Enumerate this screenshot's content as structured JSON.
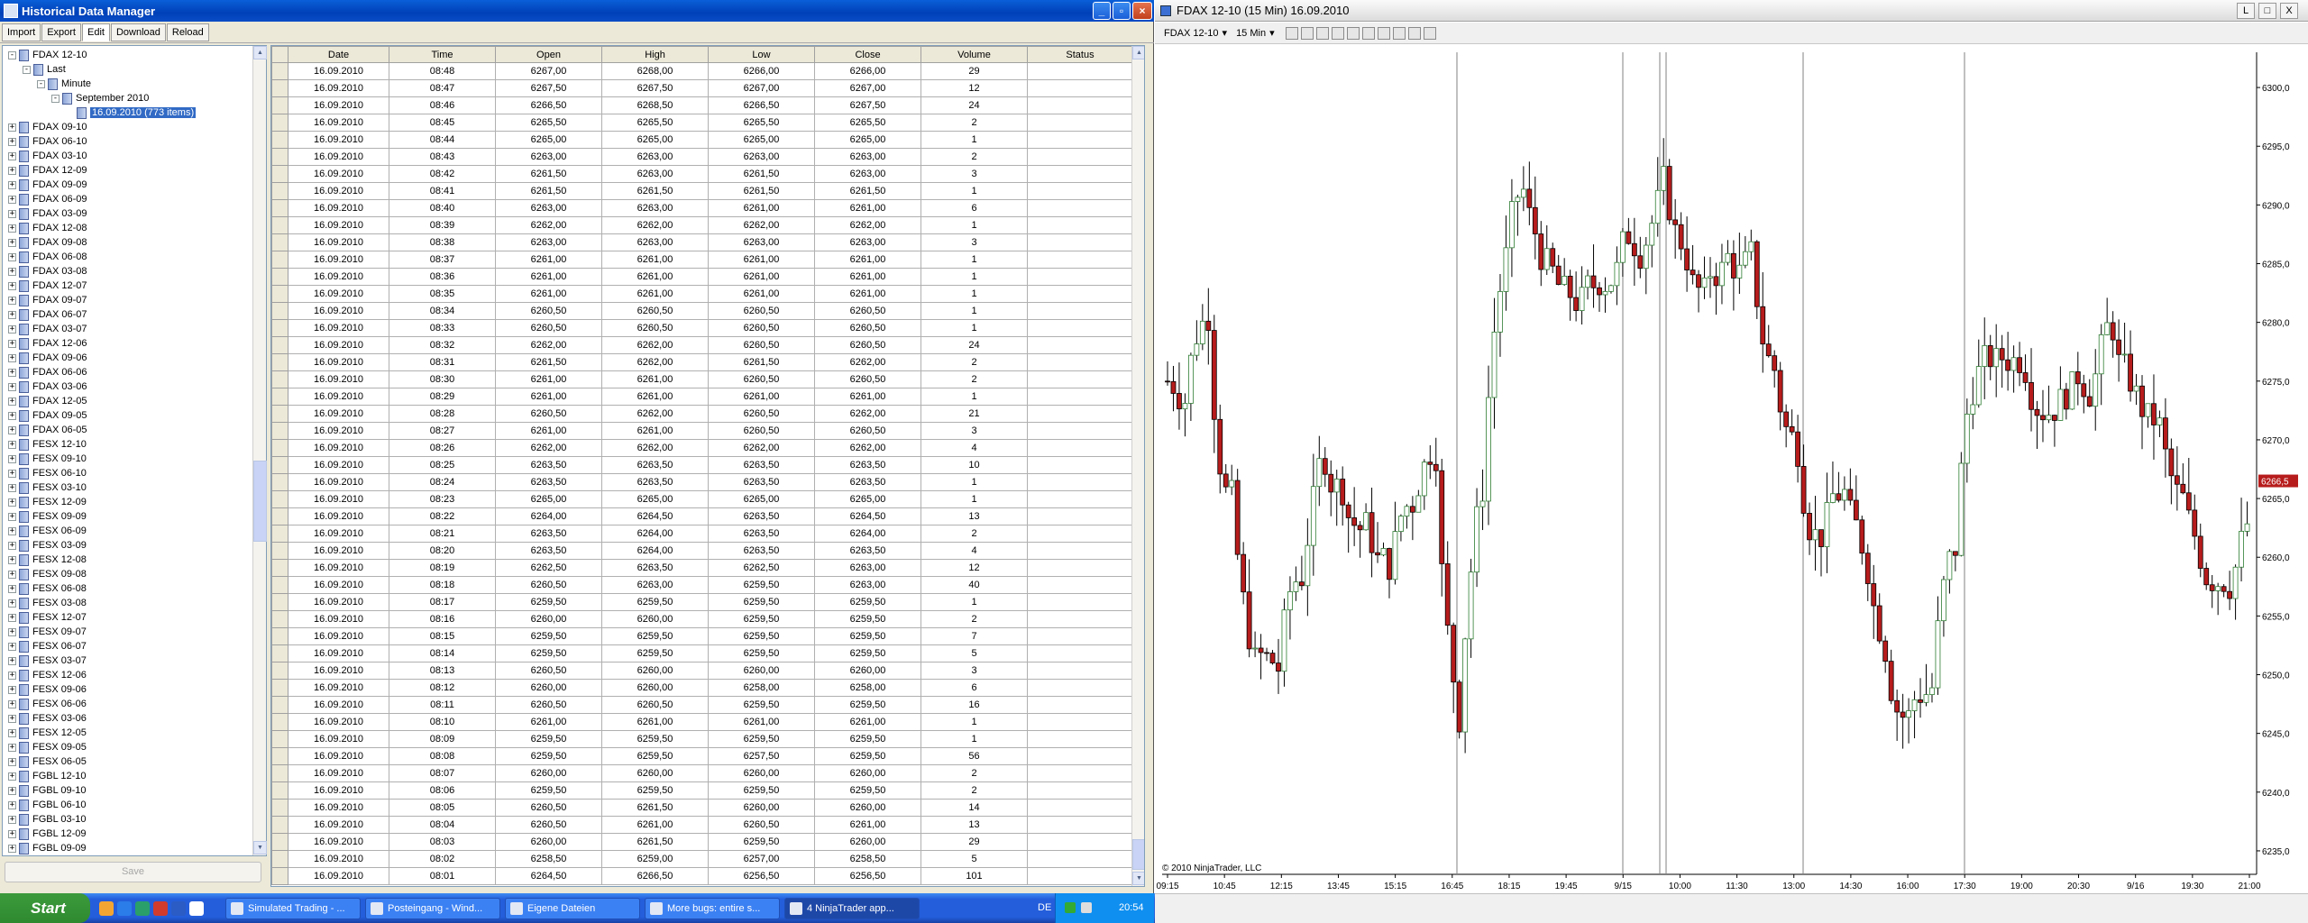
{
  "hdm": {
    "title": "Historical Data Manager",
    "menu": [
      "Import",
      "Export",
      "Edit",
      "Download",
      "Reload"
    ],
    "save": "Save"
  },
  "tree": {
    "top": [
      {
        "t": "FDAX 12-10",
        "lvl": 0,
        "pm": "-"
      },
      {
        "t": "Last",
        "lvl": 1,
        "pm": "-"
      },
      {
        "t": "Minute",
        "lvl": 2,
        "pm": "-"
      },
      {
        "t": "September 2010",
        "lvl": 3,
        "pm": "-"
      },
      {
        "t": "16.09.2010 (773 items)",
        "lvl": 4,
        "pm": "",
        "sel": true
      }
    ],
    "items": [
      "FDAX 09-10",
      "FDAX 06-10",
      "FDAX 03-10",
      "FDAX 12-09",
      "FDAX 09-09",
      "FDAX 06-09",
      "FDAX 03-09",
      "FDAX 12-08",
      "FDAX 09-08",
      "FDAX 06-08",
      "FDAX 03-08",
      "FDAX 12-07",
      "FDAX 09-07",
      "FDAX 06-07",
      "FDAX 03-07",
      "FDAX 12-06",
      "FDAX 09-06",
      "FDAX 06-06",
      "FDAX 03-06",
      "FDAX 12-05",
      "FDAX 09-05",
      "FDAX 06-05",
      "FESX 12-10",
      "FESX 09-10",
      "FESX 06-10",
      "FESX 03-10",
      "FESX 12-09",
      "FESX 09-09",
      "FESX 06-09",
      "FESX 03-09",
      "FESX 12-08",
      "FESX 09-08",
      "FESX 06-08",
      "FESX 03-08",
      "FESX 12-07",
      "FESX 09-07",
      "FESX 06-07",
      "FESX 03-07",
      "FESX 12-06",
      "FESX 09-06",
      "FESX 06-06",
      "FESX 03-06",
      "FESX 12-05",
      "FESX 09-05",
      "FESX 06-05",
      "FGBL 12-10",
      "FGBL 09-10",
      "FGBL 06-10",
      "FGBL 03-10",
      "FGBL 12-09",
      "FGBL 09-09"
    ]
  },
  "grid": {
    "columns": [
      "Date",
      "Time",
      "Open",
      "High",
      "Low",
      "Close",
      "Volume",
      "Status"
    ],
    "rows": [
      [
        "16.09.2010",
        "08:48",
        "6267,00",
        "6268,00",
        "6266,00",
        "6266,00",
        "29"
      ],
      [
        "16.09.2010",
        "08:47",
        "6267,50",
        "6267,50",
        "6267,00",
        "6267,00",
        "12"
      ],
      [
        "16.09.2010",
        "08:46",
        "6266,50",
        "6268,50",
        "6266,50",
        "6267,50",
        "24"
      ],
      [
        "16.09.2010",
        "08:45",
        "6265,50",
        "6265,50",
        "6265,50",
        "6265,50",
        "2"
      ],
      [
        "16.09.2010",
        "08:44",
        "6265,00",
        "6265,00",
        "6265,00",
        "6265,00",
        "1"
      ],
      [
        "16.09.2010",
        "08:43",
        "6263,00",
        "6263,00",
        "6263,00",
        "6263,00",
        "2"
      ],
      [
        "16.09.2010",
        "08:42",
        "6261,50",
        "6263,00",
        "6261,50",
        "6263,00",
        "3"
      ],
      [
        "16.09.2010",
        "08:41",
        "6261,50",
        "6261,50",
        "6261,50",
        "6261,50",
        "1"
      ],
      [
        "16.09.2010",
        "08:40",
        "6263,00",
        "6263,00",
        "6261,00",
        "6261,00",
        "6"
      ],
      [
        "16.09.2010",
        "08:39",
        "6262,00",
        "6262,00",
        "6262,00",
        "6262,00",
        "1"
      ],
      [
        "16.09.2010",
        "08:38",
        "6263,00",
        "6263,00",
        "6263,00",
        "6263,00",
        "3"
      ],
      [
        "16.09.2010",
        "08:37",
        "6261,00",
        "6261,00",
        "6261,00",
        "6261,00",
        "1"
      ],
      [
        "16.09.2010",
        "08:36",
        "6261,00",
        "6261,00",
        "6261,00",
        "6261,00",
        "1"
      ],
      [
        "16.09.2010",
        "08:35",
        "6261,00",
        "6261,00",
        "6261,00",
        "6261,00",
        "1"
      ],
      [
        "16.09.2010",
        "08:34",
        "6260,50",
        "6260,50",
        "6260,50",
        "6260,50",
        "1"
      ],
      [
        "16.09.2010",
        "08:33",
        "6260,50",
        "6260,50",
        "6260,50",
        "6260,50",
        "1"
      ],
      [
        "16.09.2010",
        "08:32",
        "6262,00",
        "6262,00",
        "6260,50",
        "6260,50",
        "24"
      ],
      [
        "16.09.2010",
        "08:31",
        "6261,50",
        "6262,00",
        "6261,50",
        "6262,00",
        "2"
      ],
      [
        "16.09.2010",
        "08:30",
        "6261,00",
        "6261,00",
        "6260,50",
        "6260,50",
        "2"
      ],
      [
        "16.09.2010",
        "08:29",
        "6261,00",
        "6261,00",
        "6261,00",
        "6261,00",
        "1"
      ],
      [
        "16.09.2010",
        "08:28",
        "6260,50",
        "6262,00",
        "6260,50",
        "6262,00",
        "21"
      ],
      [
        "16.09.2010",
        "08:27",
        "6261,00",
        "6261,00",
        "6260,50",
        "6260,50",
        "3"
      ],
      [
        "16.09.2010",
        "08:26",
        "6262,00",
        "6262,00",
        "6262,00",
        "6262,00",
        "4"
      ],
      [
        "16.09.2010",
        "08:25",
        "6263,50",
        "6263,50",
        "6263,50",
        "6263,50",
        "10"
      ],
      [
        "16.09.2010",
        "08:24",
        "6263,50",
        "6263,50",
        "6263,50",
        "6263,50",
        "1"
      ],
      [
        "16.09.2010",
        "08:23",
        "6265,00",
        "6265,00",
        "6265,00",
        "6265,00",
        "1"
      ],
      [
        "16.09.2010",
        "08:22",
        "6264,00",
        "6264,50",
        "6263,50",
        "6264,50",
        "13"
      ],
      [
        "16.09.2010",
        "08:21",
        "6263,50",
        "6264,00",
        "6263,50",
        "6264,00",
        "2"
      ],
      [
        "16.09.2010",
        "08:20",
        "6263,50",
        "6264,00",
        "6263,50",
        "6263,50",
        "4"
      ],
      [
        "16.09.2010",
        "08:19",
        "6262,50",
        "6263,50",
        "6262,50",
        "6263,00",
        "12"
      ],
      [
        "16.09.2010",
        "08:18",
        "6260,50",
        "6263,00",
        "6259,50",
        "6263,00",
        "40"
      ],
      [
        "16.09.2010",
        "08:17",
        "6259,50",
        "6259,50",
        "6259,50",
        "6259,50",
        "1"
      ],
      [
        "16.09.2010",
        "08:16",
        "6260,00",
        "6260,00",
        "6259,50",
        "6259,50",
        "2"
      ],
      [
        "16.09.2010",
        "08:15",
        "6259,50",
        "6259,50",
        "6259,50",
        "6259,50",
        "7"
      ],
      [
        "16.09.2010",
        "08:14",
        "6259,50",
        "6259,50",
        "6259,50",
        "6259,50",
        "5"
      ],
      [
        "16.09.2010",
        "08:13",
        "6260,50",
        "6260,00",
        "6260,00",
        "6260,00",
        "3"
      ],
      [
        "16.09.2010",
        "08:12",
        "6260,00",
        "6260,00",
        "6258,00",
        "6258,00",
        "6"
      ],
      [
        "16.09.2010",
        "08:11",
        "6260,50",
        "6260,50",
        "6259,50",
        "6259,50",
        "16"
      ],
      [
        "16.09.2010",
        "08:10",
        "6261,00",
        "6261,00",
        "6261,00",
        "6261,00",
        "1"
      ],
      [
        "16.09.2010",
        "08:09",
        "6259,50",
        "6259,50",
        "6259,50",
        "6259,50",
        "1"
      ],
      [
        "16.09.2010",
        "08:08",
        "6259,50",
        "6259,50",
        "6257,50",
        "6259,50",
        "56"
      ],
      [
        "16.09.2010",
        "08:07",
        "6260,00",
        "6260,00",
        "6260,00",
        "6260,00",
        "2"
      ],
      [
        "16.09.2010",
        "08:06",
        "6259,50",
        "6259,50",
        "6259,50",
        "6259,50",
        "2"
      ],
      [
        "16.09.2010",
        "08:05",
        "6260,50",
        "6261,50",
        "6260,00",
        "6260,00",
        "14"
      ],
      [
        "16.09.2010",
        "08:04",
        "6260,50",
        "6261,00",
        "6260,50",
        "6261,00",
        "13"
      ],
      [
        "16.09.2010",
        "08:03",
        "6260,00",
        "6261,50",
        "6259,50",
        "6260,00",
        "29"
      ],
      [
        "16.09.2010",
        "08:02",
        "6258,50",
        "6259,00",
        "6257,00",
        "6258,50",
        "5"
      ],
      [
        "16.09.2010",
        "08:01",
        "6264,50",
        "6266,50",
        "6256,50",
        "6256,50",
        "101"
      ]
    ]
  },
  "ninja": {
    "title": "FDAX 12-10 (15 Min)  16.09.2010",
    "instrument": "FDAX 12-10",
    "interval": "15 Min",
    "buttons": [
      "L",
      "□",
      "X"
    ]
  },
  "chart_data": {
    "type": "candlestick",
    "title": "FDAX 12-10 (15 Min)  16.09.2010",
    "copyright": "© 2010 NinjaTrader, LLC",
    "ylim": [
      6233,
      6303
    ],
    "yticks": [
      "6300,0",
      "6295,0",
      "6290,0",
      "6285,0",
      "6280,0",
      "6275,0",
      "6270,0",
      "6265,0",
      "6260,0",
      "6255,0",
      "6250,0",
      "6245,0",
      "6240,0",
      "6235,0"
    ],
    "ytick_values": [
      6300,
      6295,
      6290,
      6285,
      6280,
      6275,
      6270,
      6265,
      6260,
      6255,
      6250,
      6245,
      6240,
      6235
    ],
    "xticks": [
      "09:15",
      "10:45",
      "12:15",
      "13:45",
      "15:15",
      "16:45",
      "18:15",
      "19:45",
      "9/15",
      "10:00",
      "11:30",
      "13:00",
      "14:30",
      "16:00",
      "17:30",
      "19:00",
      "20:30",
      "9/16",
      "19:30",
      "21:00"
    ],
    "last_price": "6266,5",
    "up_color": "#ffffff",
    "up_border": "#2e7d32",
    "down_color": "#b71c1c",
    "wick": "#000000"
  },
  "taskbar": {
    "start": "Start",
    "tasks": [
      "Simulated Trading - ...",
      "Posteingang - Wind...",
      "Eigene Dateien",
      "More bugs: entire s...",
      "4 NinjaTrader app..."
    ],
    "lang": "DE",
    "clock": "20:54"
  }
}
